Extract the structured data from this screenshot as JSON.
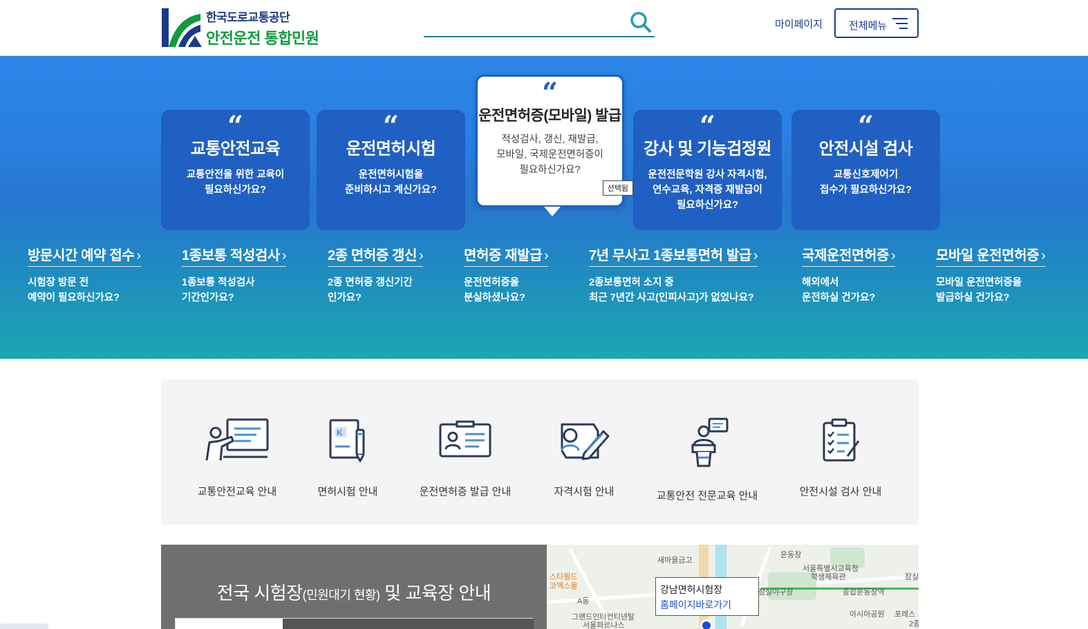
{
  "header": {
    "org_name": "한국도로교통공단",
    "service_name": "안전운전 통합민원",
    "search_placeholder": "",
    "mypage_label": "마이페이지",
    "allmenu_label": "전체메뉴"
  },
  "cards": [
    {
      "title": "교통안전교육",
      "desc1": "교통안전을 위한 교육이",
      "desc2": "필요하신가요?",
      "desc3": ""
    },
    {
      "title": "운전면허시험",
      "desc1": "운전면허시험을",
      "desc2": "준비하시고 계신가요?",
      "desc3": ""
    },
    {
      "title": "운전면허증(모바일) 발급",
      "desc1": "적성검사, 갱신, 재발급,",
      "desc2": "모바일, 국제운전면허증이",
      "desc3": "필요하신가요?",
      "badge": "선택됨"
    },
    {
      "title": "강사 및 기능검정원",
      "desc1": "운전전문학원 강사 자격시험,",
      "desc2": "연수교육, 자격증 재발급이",
      "desc3": "필요하신가요?"
    },
    {
      "title": "안전시설 검사",
      "desc1": "교통신호제어기",
      "desc2": "접수가 필요하신가요?",
      "desc3": ""
    }
  ],
  "quick_links": [
    {
      "title": "방문시간 예약 접수",
      "line1": "시험장 방문 전",
      "line2": "예약이 필요하신가요?"
    },
    {
      "title": "1종보통 적성검사",
      "line1": "1종보통 적성검사",
      "line2": "기간인가요?"
    },
    {
      "title": "2종 면허증 갱신",
      "line1": "2종 면허증 갱신기간",
      "line2": "인가요?"
    },
    {
      "title": "면허증 재발급",
      "line1": "운전면허증을",
      "line2": "분실하셨나요?"
    },
    {
      "title": "7년 무사고 1종보통면허 발급",
      "line1": "2종보통면허 소지 중",
      "line2": "최근 7년간 사고(인피사고)가 없었나요?"
    },
    {
      "title": "국제운전면허증",
      "line1": "해외에서",
      "line2": "운전하실 건가요?"
    },
    {
      "title": "모바일 운전면허증",
      "line1": "모바일 운전면허증을",
      "line2": "발급하실 건가요?"
    }
  ],
  "services": [
    {
      "label": "교통안전교육 안내",
      "icon": "lecture-icon"
    },
    {
      "label": "면허시험 안내",
      "icon": "exam-book-icon"
    },
    {
      "label": "운전면허증 발급 안내",
      "icon": "license-card-icon"
    },
    {
      "label": "자격시험 안내",
      "icon": "qualification-icon"
    },
    {
      "label": "교통안전 전문교육 안내",
      "icon": "speaker-icon"
    },
    {
      "label": "안전시설 검사 안내",
      "icon": "checklist-icon"
    }
  ],
  "center": {
    "title_a": "전국 시험장",
    "title_b": "(민원대기 현황)",
    "title_c": "및 교육장 안내"
  },
  "map": {
    "popup_name": "강남면허시험장",
    "popup_link": "홈페이지바로가기",
    "labels": [
      "새마을금고",
      "스타필드",
      "코엑스몰",
      "A동",
      "그랜드인터컨티넨탈",
      "서울파르나스",
      "잠실야구장",
      "종합운동장역",
      "아시아공원",
      "서울특별시교육청",
      "학생체육관",
      "운동장",
      "포레스",
      "잠실",
      "2종"
    ]
  },
  "colors": {
    "brand_blue": "#1a3b8c",
    "brand_green": "#0f9b3c",
    "card_blue": "#1d5fc4"
  }
}
